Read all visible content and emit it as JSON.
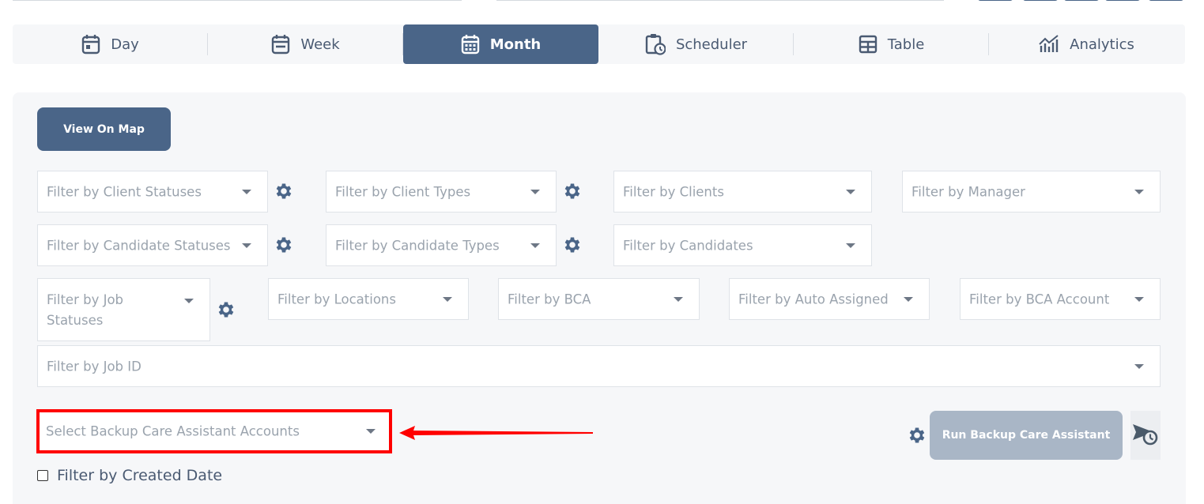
{
  "tabs": [
    {
      "label": "Day",
      "icon": "calendar-day-icon",
      "active": false
    },
    {
      "label": "Week",
      "icon": "calendar-week-icon",
      "active": false
    },
    {
      "label": "Month",
      "icon": "calendar-month-icon",
      "active": true
    },
    {
      "label": "Scheduler",
      "icon": "clipboard-clock-icon",
      "active": false
    },
    {
      "label": "Table",
      "icon": "table-icon",
      "active": false
    },
    {
      "label": "Analytics",
      "icon": "analytics-chart-icon",
      "active": false
    }
  ],
  "view_on_map": "View On Map",
  "filters": {
    "client_statuses": "Filter by Client Statuses",
    "client_types": "Filter by Client Types",
    "clients": "Filter by Clients",
    "manager": "Filter by Manager",
    "candidate_statuses": "Filter by Candidate Statuses",
    "candidate_types": "Filter by Candidate Types",
    "candidates": "Filter by Candidates",
    "job_statuses": "Filter by Job Statuses",
    "locations": "Filter by Locations",
    "bca": "Filter by BCA",
    "auto_assigned": "Filter by Auto Assigned",
    "bca_account": "Filter by BCA Account",
    "job_id": "Filter by Job ID"
  },
  "bca_accounts_select": "Select Backup Care Assistant Accounts",
  "run_bca_button": "Run Backup Care Assistant",
  "created_date_label": "Filter by Created Date",
  "colors": {
    "primary": "#4a6588",
    "primary_disabled": "#a9b6c6",
    "highlight": "#ff0000",
    "panel_bg": "#f6f7f9"
  }
}
